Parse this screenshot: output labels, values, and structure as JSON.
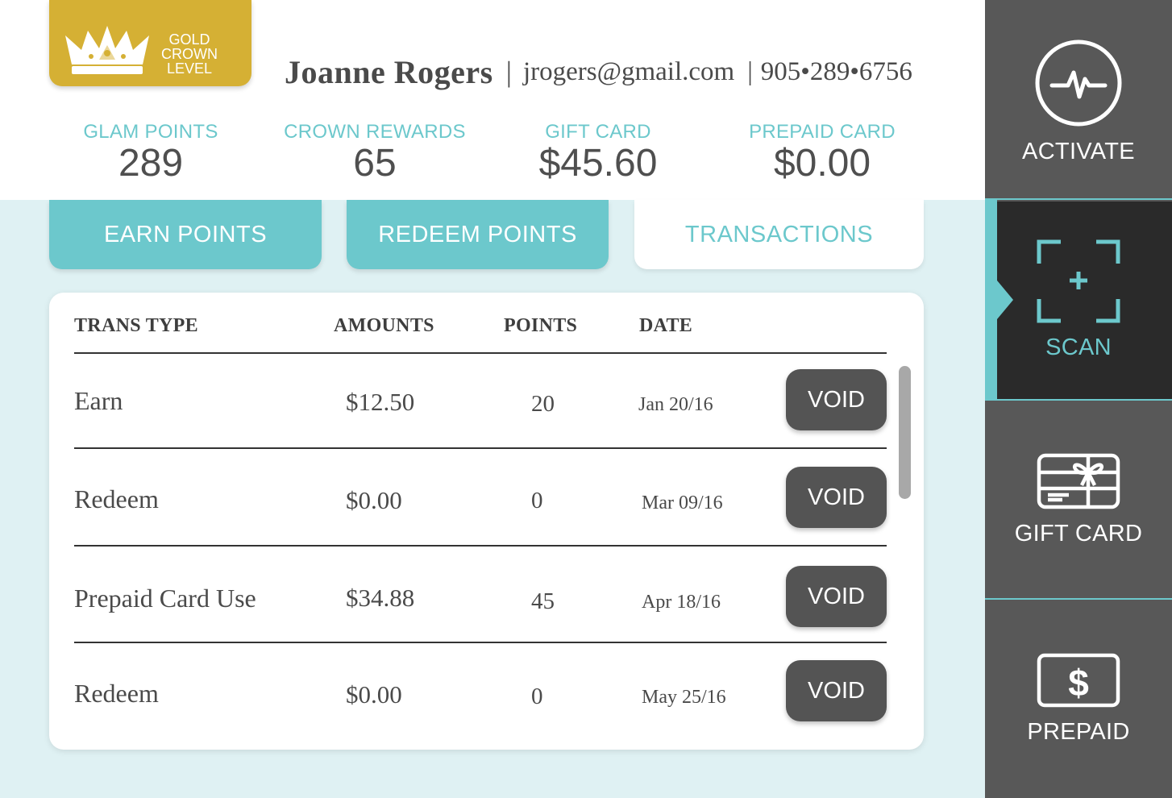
{
  "badge": {
    "line1": "GOLD",
    "line2": "CROWN",
    "line3": "LEVEL",
    "icon": "crown-icon",
    "color": "#d5b034"
  },
  "customer": {
    "name": "Joanne Rogers",
    "separator": "|",
    "email": "jrogers@gmail.com",
    "phone_separator": "|",
    "phone": "905•289•6756"
  },
  "stats": [
    {
      "label": "GLAM POINTS",
      "value": "289"
    },
    {
      "label": "CROWN REWARDS",
      "value": "65"
    },
    {
      "label": "GIFT CARD",
      "value": "$45.60"
    },
    {
      "label": "PREPAID CARD",
      "value": "$0.00"
    }
  ],
  "tabs": [
    {
      "label": "EARN POINTS",
      "active": false
    },
    {
      "label": "REDEEM POINTS",
      "active": false
    },
    {
      "label": "TRANSACTIONS",
      "active": true
    }
  ],
  "table": {
    "headers": {
      "type": "TRANS TYPE",
      "amount": "AMOUNTS",
      "points": "POINTS",
      "date": "DATE"
    },
    "rows": [
      {
        "type": "Earn",
        "amount": "$12.50",
        "points": "20",
        "date": "Jan 20/16",
        "action": "VOID"
      },
      {
        "type": "Redeem",
        "amount": "$0.00",
        "points": "0",
        "date": "Mar 09/16",
        "action": "VOID"
      },
      {
        "type": "Prepaid Card Use",
        "amount": "$34.88",
        "points": "45",
        "date": "Apr 18/16",
        "action": "VOID"
      },
      {
        "type": "Redeem",
        "amount": "$0.00",
        "points": "0",
        "date": "May 25/16",
        "action": "VOID"
      }
    ]
  },
  "sidebar": {
    "items": [
      {
        "label": "ACTIVATE",
        "icon": "pulse-icon",
        "active": false
      },
      {
        "label": "SCAN",
        "icon": "scan-icon",
        "active": true
      },
      {
        "label": "GIFT CARD",
        "icon": "gift-card-icon",
        "active": false
      },
      {
        "label": "PREPAID",
        "icon": "dollar-card-icon",
        "active": false
      }
    ]
  },
  "colors": {
    "accent": "#6cc8cc",
    "gold": "#d5b034",
    "dark": "#585858",
    "active": "#2a2a2a",
    "background": "#dff1f3"
  }
}
